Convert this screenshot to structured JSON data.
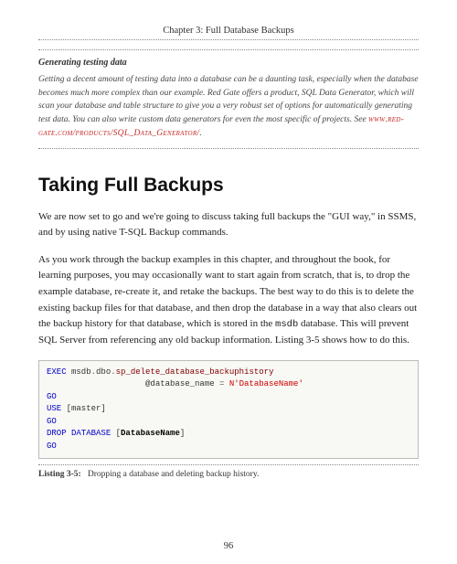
{
  "chapter_header": "Chapter 3: Full Database Backups",
  "callout": {
    "title": "Generating testing data",
    "body_pre": "Getting a decent amount of testing data into a database can be a daunting task, especially when the database becomes much more complex than our example. Red Gate offers a product, SQL Data Generator, which will scan your database and table structure to give you a very robust set of options for automatically generating test data.  You can also write custom data generators for even the most specific of projects. See ",
    "link_text": "www.red-gate.com/products/SQL_Data_Generator/",
    "body_post": "."
  },
  "section_heading": "Taking Full Backups",
  "para1": "We are now set to go and we're going to discuss taking full backups the \"GUI way,\" in SSMS, and by using native T-SQL Backup commands.",
  "para2_pre": "As you work through the backup examples in this chapter, and throughout the book, for learning purposes, you may occasionally want to start again from scratch, that is, to drop the example database, re-create it, and retake the backups. The best way to do this is to delete the existing backup files for that database, and then drop the database in a way that also clears out the backup history for that database, which is stored in the ",
  "para2_mono": "msdb",
  "para2_post": " database. This will prevent SQL Server from referencing any old backup information. Listing 3-5 shows how to do this.",
  "code": {
    "l1_a": "EXEC",
    "l1_b": " msdb",
    "l1_c": ".",
    "l1_d": "dbo",
    "l1_e": ".",
    "l1_f": "sp_delete_database_backuphistory",
    "l2_a": "                    @database_name ",
    "l2_b": "=",
    "l2_c": " N'DatabaseName'",
    "l3": "GO",
    "l4_a": "USE",
    "l4_b": " [master]",
    "l5": "GO",
    "l6_a": "DROP",
    "l6_b": " DATABASE",
    "l6_c": " [",
    "l6_d": "DatabaseName",
    "l6_e": "]",
    "l7": "GO"
  },
  "listing_label": "Listing 3-5:",
  "listing_text": "Dropping a database and deleting backup history.",
  "page_number": "96"
}
